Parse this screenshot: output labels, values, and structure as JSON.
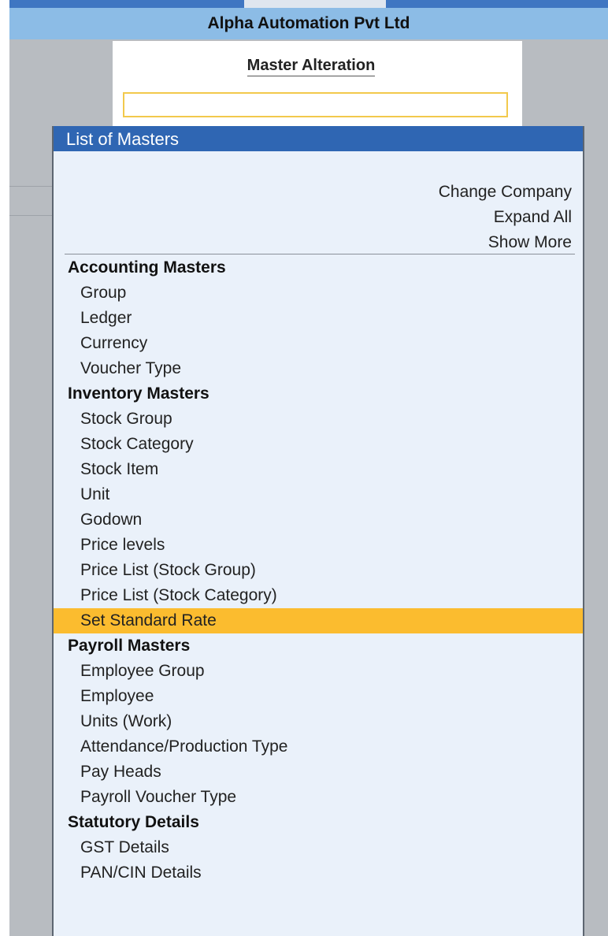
{
  "company": {
    "name": "Alpha Automation Pvt Ltd"
  },
  "alteration": {
    "title": "Master Alteration",
    "input_value": ""
  },
  "list": {
    "title": "List of Masters",
    "actions": [
      "Change Company",
      "Expand All",
      "Show More"
    ],
    "sections": [
      {
        "label": "Accounting Masters",
        "items": [
          "Group",
          "Ledger",
          "Currency",
          "Voucher Type"
        ]
      },
      {
        "label": "Inventory Masters",
        "items": [
          "Stock Group",
          "Stock Category",
          "Stock Item",
          "Unit",
          "Godown",
          "Price levels",
          "Price List (Stock Group)",
          "Price List (Stock Category)",
          "Set Standard Rate"
        ]
      },
      {
        "label": "Payroll Masters",
        "items": [
          "Employee Group",
          "Employee",
          "Units (Work)",
          "Attendance/Production Type",
          "Pay Heads",
          "Payroll Voucher Type"
        ]
      },
      {
        "label": "Statutory Details",
        "items": [
          "GST Details",
          "PAN/CIN Details"
        ]
      }
    ],
    "selected_item": "Set Standard Rate"
  },
  "colors": {
    "title_bar": "#8cbce6",
    "list_header": "#2f66b3",
    "list_background": "#eaf1fa",
    "selection": "#fbbc2f",
    "input_border": "#f2c94c"
  }
}
